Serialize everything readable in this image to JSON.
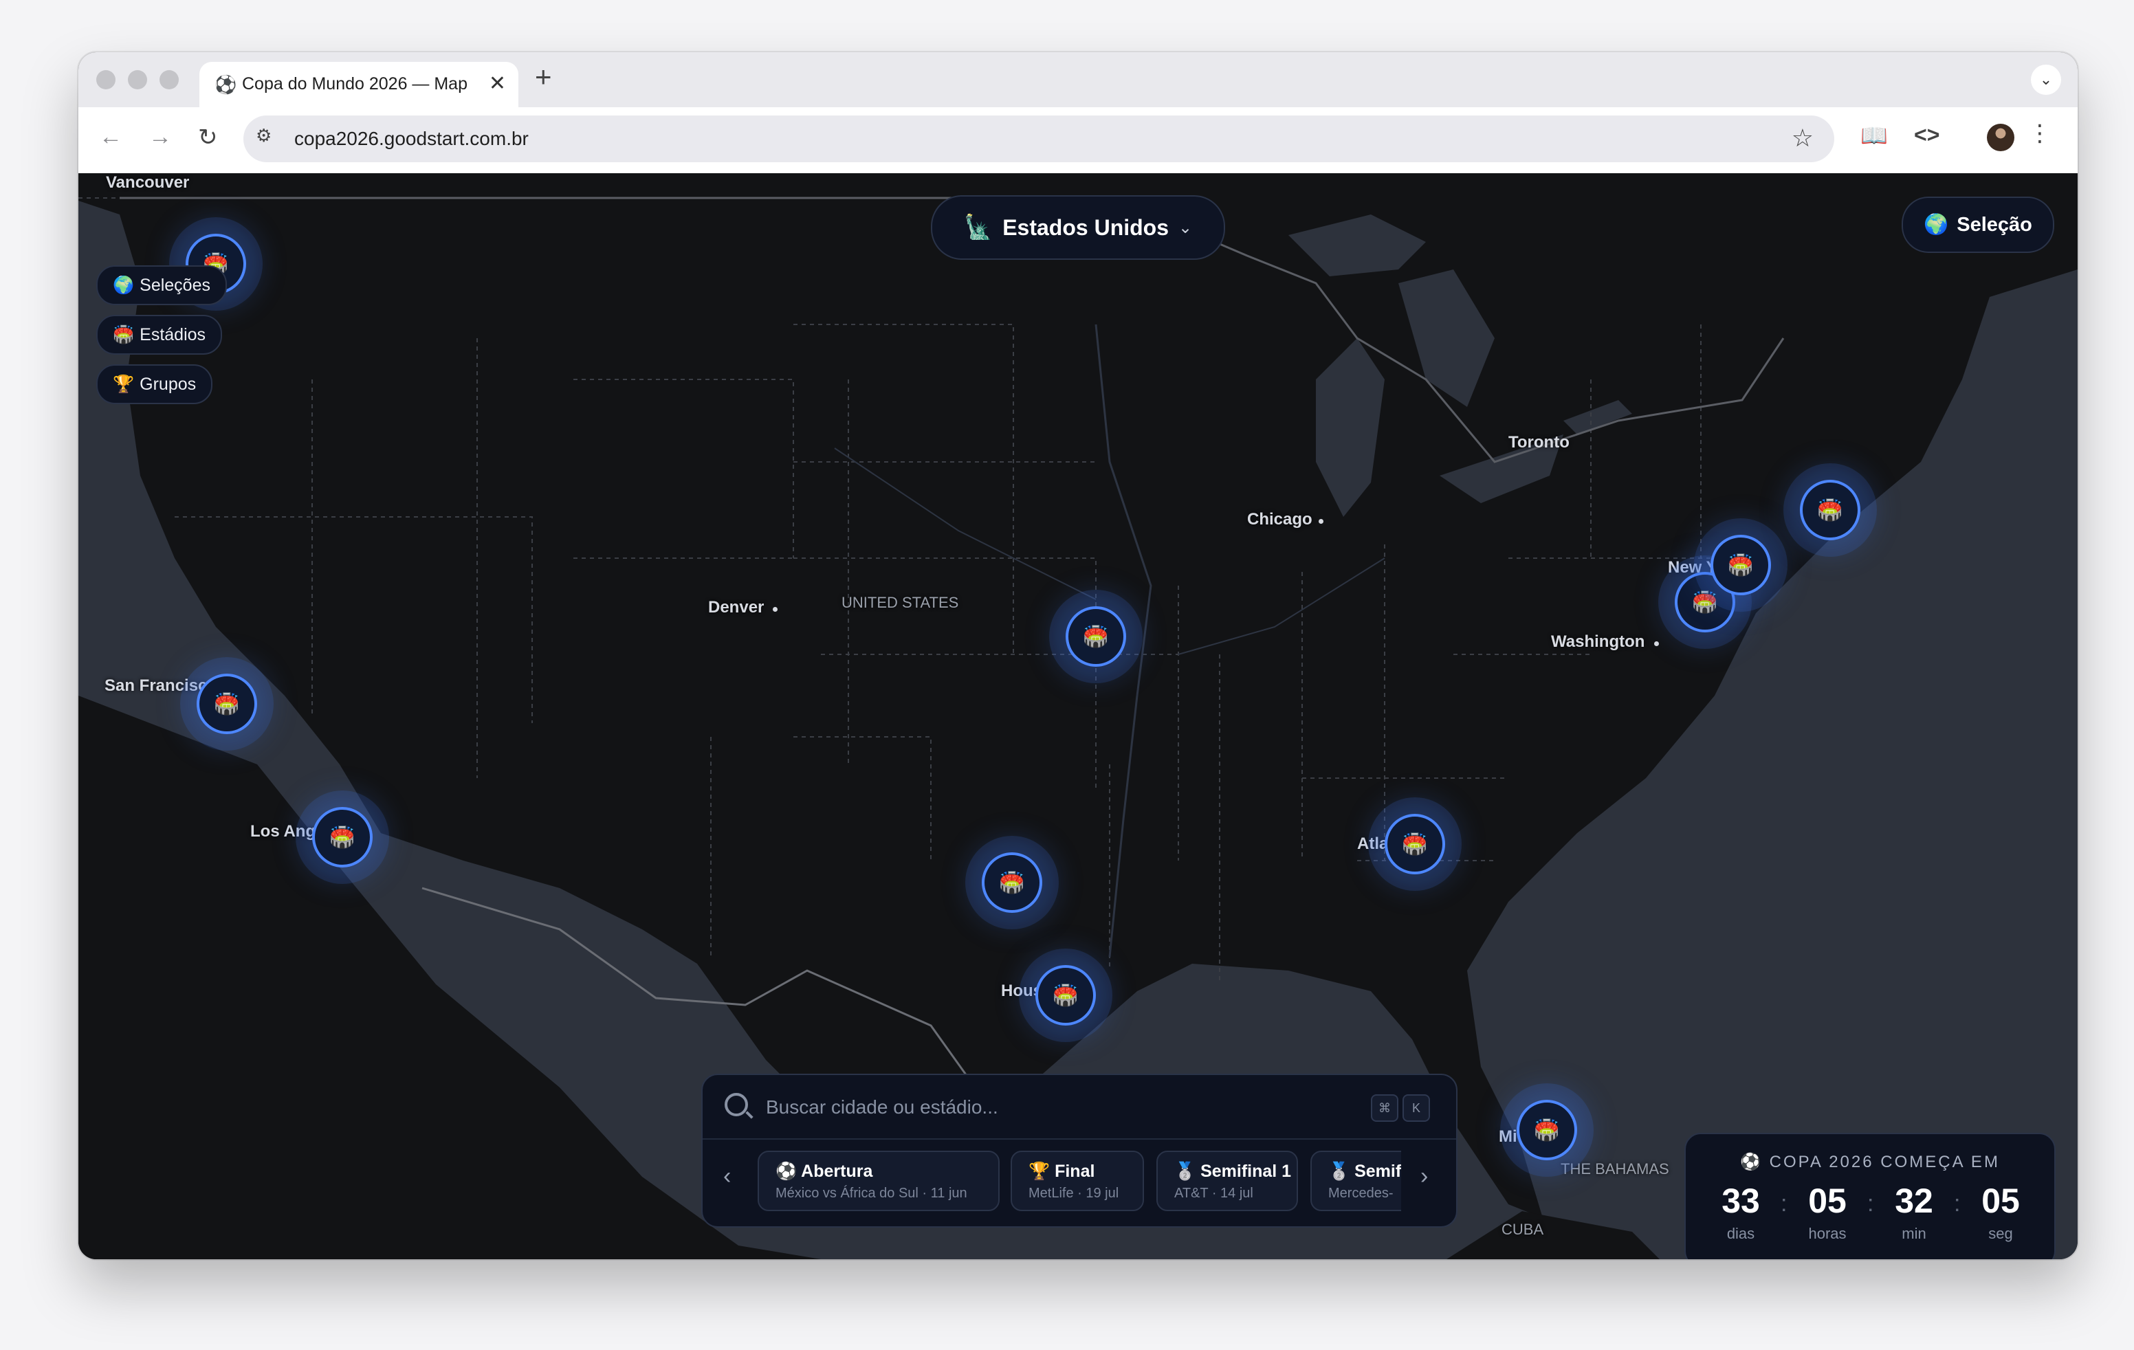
{
  "browser": {
    "tab_title": "Copa do Mundo 2026 — Map",
    "tab_favicon": "⚽",
    "url": "copa2026.goodstart.com.br"
  },
  "map": {
    "country_selector": {
      "flag": "🗽",
      "label": "Estados Unidos"
    },
    "selecao_button": {
      "icon": "🌍",
      "label": "Seleção"
    },
    "side_menu": [
      {
        "icon": "🌍",
        "label": "Seleções"
      },
      {
        "icon": "🏟️",
        "label": "Estádios"
      },
      {
        "icon": "🏆",
        "label": "Grupos"
      }
    ],
    "labels": {
      "vancouver": "Vancouver",
      "toronto": "Toronto",
      "chicago": "Chicago",
      "denver": "Denver",
      "united_states": "UNITED STATES",
      "new_york": "New Y",
      "washington": "Washington",
      "san_francisco": "San Francisc",
      "los_angeles": "Los Ang",
      "atlanta": "Atla",
      "houston": "Hous",
      "miami": "Mi",
      "bahamas": "THE BAHAMAS",
      "cuba": "CUBA"
    },
    "stadium_icon": "🏟️",
    "stadium_count": 11
  },
  "search": {
    "placeholder": "Buscar cidade ou estádio...",
    "shortcut_keys": [
      "⌘",
      "K"
    ],
    "chips": [
      {
        "icon": "⚽",
        "title": "Abertura",
        "subtitle": "México vs África do Sul · 11 jun"
      },
      {
        "icon": "🏆",
        "title": "Final",
        "subtitle": "MetLife · 19 jul"
      },
      {
        "icon": "🥈",
        "title": "Semifinal 1",
        "subtitle": "AT&T · 14 jul"
      },
      {
        "icon": "🥈",
        "title": "Semifi",
        "subtitle": "Mercedes-"
      }
    ]
  },
  "countdown": {
    "title": "COPA 2026 COMEÇA EM",
    "icon": "⚽",
    "units": [
      {
        "value": "33",
        "label": "dias"
      },
      {
        "value": "05",
        "label": "horas"
      },
      {
        "value": "32",
        "label": "min"
      },
      {
        "value": "05",
        "label": "seg"
      }
    ]
  }
}
